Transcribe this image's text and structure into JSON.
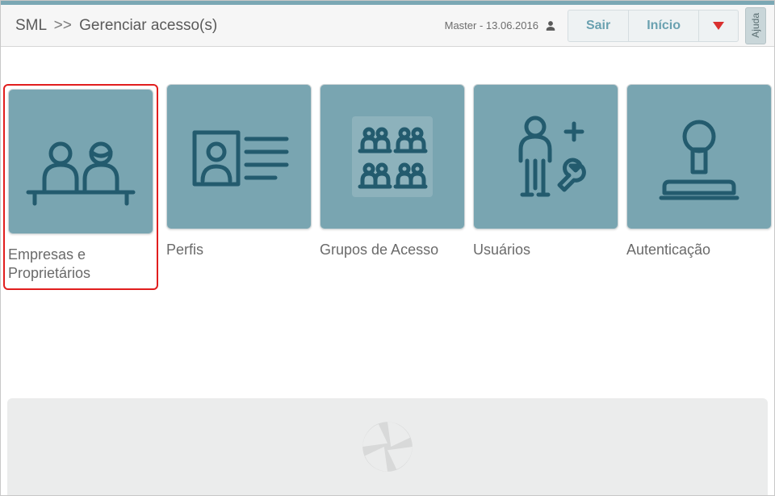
{
  "header": {
    "breadcrumb_root": "SML",
    "breadcrumb_sep": ">>",
    "breadcrumb_current": "Gerenciar acesso(s)",
    "user_label": "Master - 13.06.2016",
    "logout_label": "Sair",
    "home_label": "Início",
    "help_label": "Ajuda"
  },
  "tiles": [
    {
      "key": "empresas",
      "label": "Empresas e Proprietários",
      "highlight": true
    },
    {
      "key": "perfis",
      "label": "Perfis",
      "highlight": false
    },
    {
      "key": "grupos",
      "label": "Grupos de Acesso",
      "highlight": false
    },
    {
      "key": "usuarios",
      "label": "Usuários",
      "highlight": false
    },
    {
      "key": "autenticacao",
      "label": "Autenticação",
      "highlight": false
    }
  ]
}
